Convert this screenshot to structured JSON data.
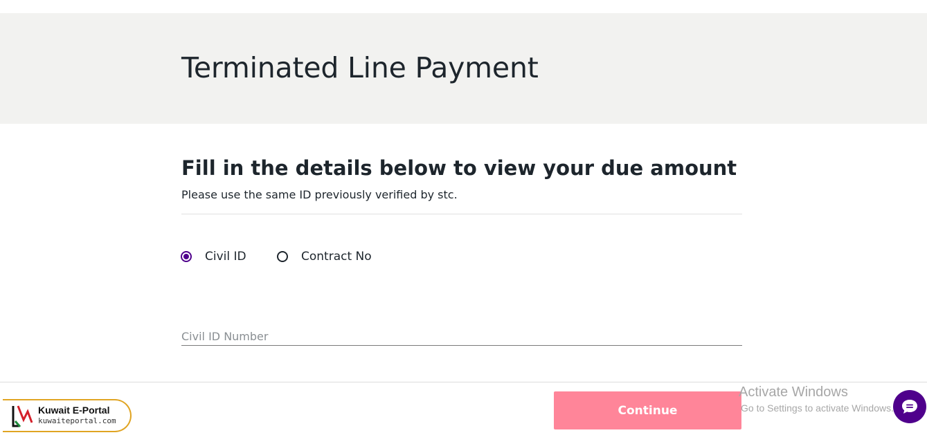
{
  "header": {
    "title": "Terminated Line Payment"
  },
  "form": {
    "heading": "Fill in the details below to view your due amount",
    "subtitle": "Please use the same ID previously verified by stc.",
    "id_type_options": [
      {
        "label": "Civil ID",
        "selected": true
      },
      {
        "label": "Contract No",
        "selected": false
      }
    ],
    "civil_id_input": {
      "value": "",
      "placeholder": "Civil ID Number"
    },
    "continue_label": "Continue"
  },
  "watermark": {
    "title": "Activate Windows",
    "subtitle": "Go to Settings to activate Windows."
  },
  "chat": {
    "icon": "chat-bubble-icon"
  },
  "logo": {
    "name": "Kuwait E-Portal",
    "url": "kuwaiteportal.com"
  },
  "colors": {
    "accent": "#4f008c",
    "continue_button": "#ff8599",
    "hero_background": "#f2f2f0",
    "logo_border": "#e0a422"
  }
}
